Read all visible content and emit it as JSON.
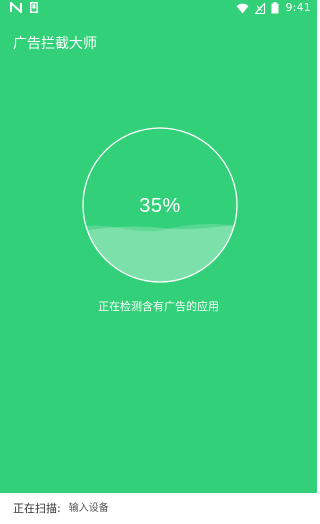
{
  "status_bar": {
    "time": "9:41",
    "icons_left": [
      "n-icon",
      "notification-icon"
    ],
    "icons_right": [
      "wifi-icon",
      "signal-icon",
      "battery-icon"
    ]
  },
  "header": {
    "title": "广告拦截大师"
  },
  "scan": {
    "progress_text": "35%",
    "progress_value": 0.35,
    "caption": "正在检测含有广告的应用"
  },
  "footer": {
    "label": "正在扫描:",
    "target": "输入设备"
  },
  "colors": {
    "primary_green": "#33D07A",
    "text_on_green": "#FFFFFF",
    "footer_bg": "#FFFFFF",
    "footer_text": "#333333"
  }
}
